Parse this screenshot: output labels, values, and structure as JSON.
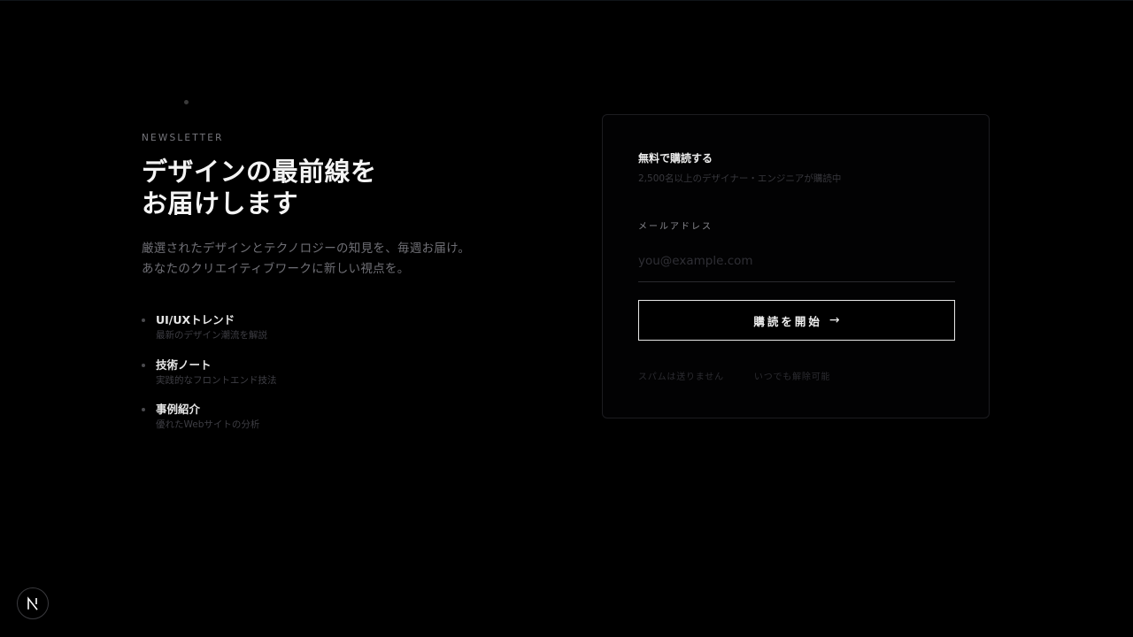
{
  "newsletter": {
    "eyebrow": "NEWSLETTER",
    "headline_line1": "デザインの最前線を",
    "headline_line2": "お届けします",
    "desc_line1": "厳選されたデザインとテクノロジーの知見を、毎週お届け。",
    "desc_line2": "あなたのクリエイティブワークに新しい視点を。",
    "features": [
      {
        "title": "UI/UXトレンド",
        "subtitle": "最新のデザイン潮流を解説"
      },
      {
        "title": "技術ノート",
        "subtitle": "実践的なフロントエンド技法"
      },
      {
        "title": "事例紹介",
        "subtitle": "優れたWebサイトの分析"
      }
    ]
  },
  "form": {
    "title": "無料で購読する",
    "subtitle": "2,500名以上のデザイナー・エンジニアが購読中",
    "email_label": "メールアドレス",
    "email_placeholder": "you@example.com",
    "email_value": "",
    "submit_label": "購読を開始",
    "submit_arrow": "→",
    "note_spam": "スパムは送りません",
    "note_unsubscribe": "いつでも解除可能"
  },
  "logo": {
    "icon": "next-logo-icon"
  }
}
